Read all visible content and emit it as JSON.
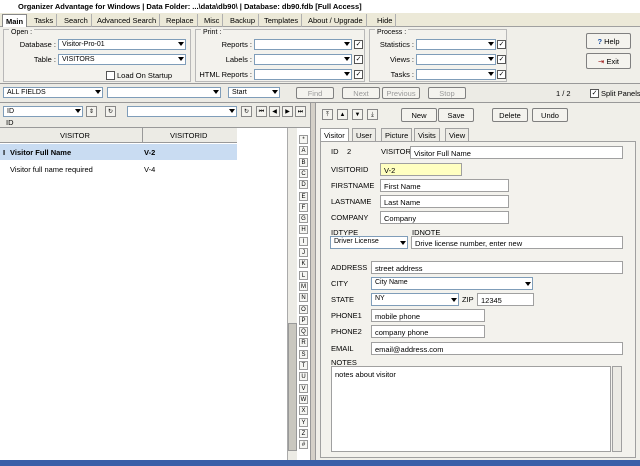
{
  "title": "Organizer Advantage for Windows | Data Folder: ...\\data\\db90\\ | Database: db90.fdb [Full Access]",
  "tabs": [
    "Main",
    "Tasks",
    "Search",
    "Advanced Search",
    "Replace",
    "Misc",
    "Backup",
    "Templates",
    "About / Upgrade",
    "Hide"
  ],
  "open_group": {
    "title": "Open :",
    "database_label": "Database :",
    "database_value": "Visitor-Pro-01",
    "table_label": "Table :",
    "table_value": "VISITORS",
    "load_startup": "Load On Startup"
  },
  "print_group": {
    "title": "Print :",
    "reports": "Reports :",
    "labels": "Labels :",
    "html_reports": "HTML Reports :"
  },
  "process_group": {
    "title": "Process :",
    "statistics": "Statistics :",
    "views": "Views :",
    "tasks": "Tasks :"
  },
  "help": "Help",
  "exit": "Exit",
  "search": {
    "field": "ALL FIELDS",
    "mode": "Start",
    "find": "Find",
    "next": "Next",
    "previous": "Previous",
    "stop": "Stop",
    "page": "1 / 2",
    "split": "Split Panels"
  },
  "sort": {
    "field": "ID",
    "sub": "ID"
  },
  "grid": {
    "headers": [
      "VISITOR",
      "VISITORID"
    ],
    "rows": [
      {
        "marker": "I",
        "visitor": "Visitor Full Name",
        "id": "V-2"
      },
      {
        "marker": "",
        "visitor": "Visitor full name required",
        "id": "V-4"
      }
    ]
  },
  "alphabet": [
    "*",
    "A",
    "B",
    "C",
    "D",
    "E",
    "F",
    "G",
    "H",
    "I",
    "J",
    "K",
    "L",
    "M",
    "N",
    "O",
    "P",
    "Q",
    "R",
    "S",
    "T",
    "U",
    "V",
    "W",
    "X",
    "Y",
    "Z",
    "#"
  ],
  "actions": {
    "new": "New",
    "save": "Save",
    "delete": "Delete",
    "undo": "Undo"
  },
  "subtabs": [
    "Visitor",
    "User",
    "Picture",
    "Visits",
    "View"
  ],
  "record": {
    "id_label": "ID",
    "id_value": "2",
    "visitor_label": "VISITOR",
    "visitor_value": "Visitor Full Name",
    "visitorid_label": "VISITORID",
    "visitorid_value": "V-2",
    "firstname_label": "FIRSTNAME",
    "firstname_value": "First Name",
    "lastname_label": "LASTNAME",
    "lastname_value": "Last Name",
    "company_label": "COMPANY",
    "company_value": "Company",
    "idtype_label": "IDTYPE",
    "idtype_value": "Driver License",
    "idnote_label": "IDNOTE",
    "idnote_value": "Drive license number, enter new",
    "address_label": "ADDRESS",
    "address_value": "street address",
    "city_label": "CITY",
    "city_value": "City Name",
    "state_label": "STATE",
    "state_value": "NY",
    "zip_label": "ZIP",
    "zip_value": "12345",
    "phone1_label": "PHONE1",
    "phone1_value": "mobile phone",
    "phone2_label": "PHONE2",
    "phone2_value": "company phone",
    "email_label": "EMAIL",
    "email_value": "email@address.com",
    "notes_label": "NOTES",
    "notes_value": "notes about visitor"
  },
  "colors": {
    "accent": "#d8e8f8",
    "selected_row": "#c9dcf2",
    "highlight_field": "#ffffc0"
  }
}
